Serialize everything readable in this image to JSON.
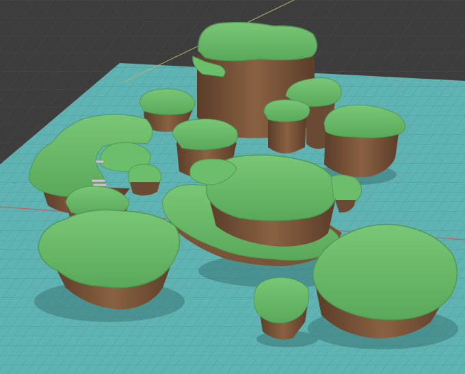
{
  "scene": {
    "type": "3d-viewport",
    "colors": {
      "background": "#3d3d3d",
      "ground_plane": "#5fb3b3",
      "grass": "#6cbf6a",
      "grass_shadow": "#4f9a52",
      "dirt": "#7a5438",
      "dirt_dark": "#5b3d29",
      "axis_red": "#c06060",
      "axis_yellow": "#b9b26a"
    },
    "objects": [
      {
        "name": "tall-cliff-island"
      },
      {
        "name": "small-pillar-island"
      },
      {
        "name": "right-pillar-island"
      },
      {
        "name": "center-central-island"
      },
      {
        "name": "front-left-island"
      },
      {
        "name": "front-right-island"
      },
      {
        "name": "front-small-island"
      },
      {
        "name": "left-ring-island"
      },
      {
        "name": "stairs"
      }
    ]
  }
}
